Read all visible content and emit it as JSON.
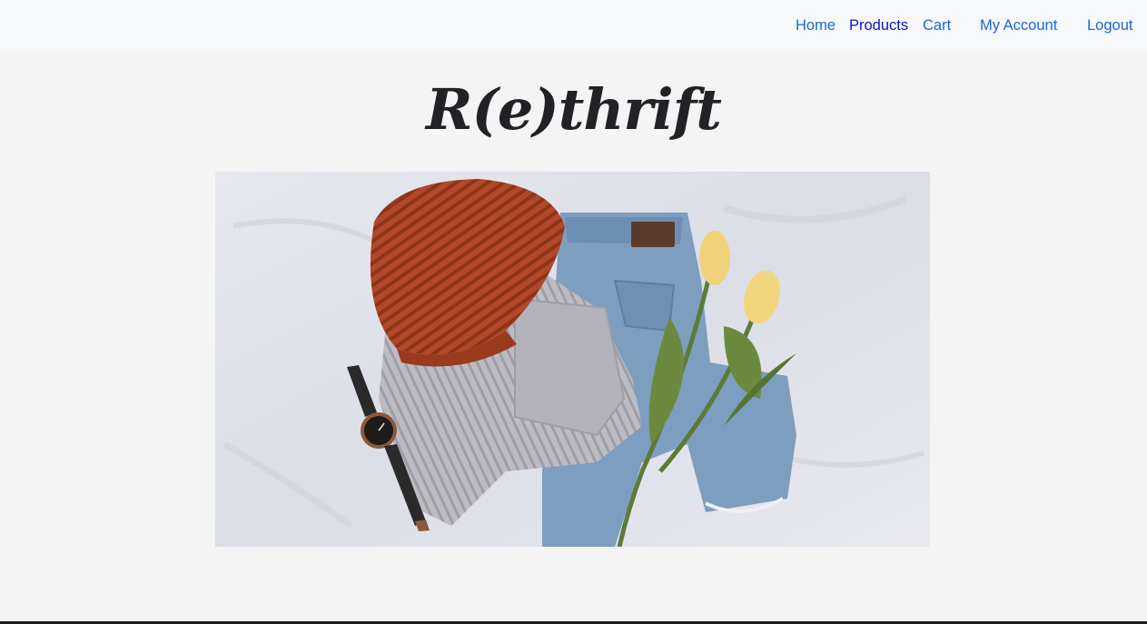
{
  "nav": {
    "home": "Home",
    "products": "Products",
    "cart": "Cart",
    "account": "My Account",
    "logout": "Logout"
  },
  "brand": {
    "title": "R(e)thrift"
  },
  "hero": {
    "items": [
      "knit-beanie",
      "gray-sweater",
      "denim-jeans",
      "wristwatch",
      "yellow-tulips"
    ],
    "colors": {
      "background": "#dfe1e8",
      "beanie": "#b1482a",
      "sweater": "#b9b8bf",
      "denim": "#7e9ebf",
      "tulip": "#f1d27a",
      "stem": "#5d7a3a",
      "watch_strap": "#2a2a2a"
    }
  },
  "colors": {
    "page_bg": "#f4f4f5",
    "nav_bg": "#f7f8f9",
    "link": "#1a66d9",
    "link_active": "#0b13c8",
    "brand_text": "#212226"
  }
}
